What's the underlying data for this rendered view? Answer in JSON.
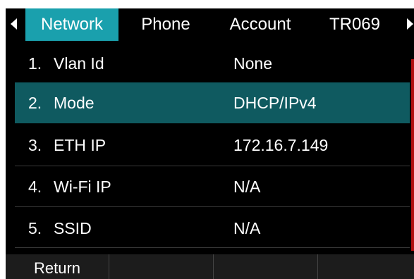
{
  "tabs": [
    {
      "label": "Network",
      "active": true
    },
    {
      "label": "Phone",
      "active": false
    },
    {
      "label": "Account",
      "active": false
    },
    {
      "label": "TR069",
      "active": false
    }
  ],
  "rows": [
    {
      "index": "1.",
      "label": "Vlan Id",
      "value": "None",
      "selected": false
    },
    {
      "index": "2.",
      "label": "Mode",
      "value": "DHCP/IPv4",
      "selected": true
    },
    {
      "index": "3.",
      "label": "ETH IP",
      "value": "172.16.7.149",
      "selected": false
    },
    {
      "index": "4.",
      "label": "Wi-Fi IP",
      "value": "N/A",
      "selected": false
    },
    {
      "index": "5.",
      "label": "SSID",
      "value": "N/A",
      "selected": false
    }
  ],
  "softkeys": [
    "Return",
    "",
    "",
    ""
  ],
  "colors": {
    "active_tab": "#1aa0ad",
    "selected_row": "#0f5a60",
    "background": "#000000",
    "softkey_bar": "#1c1c1c",
    "scrollbar": "#b01010"
  },
  "icons": {
    "tab_prev": "caret-left-icon",
    "tab_next": "caret-right-icon"
  }
}
